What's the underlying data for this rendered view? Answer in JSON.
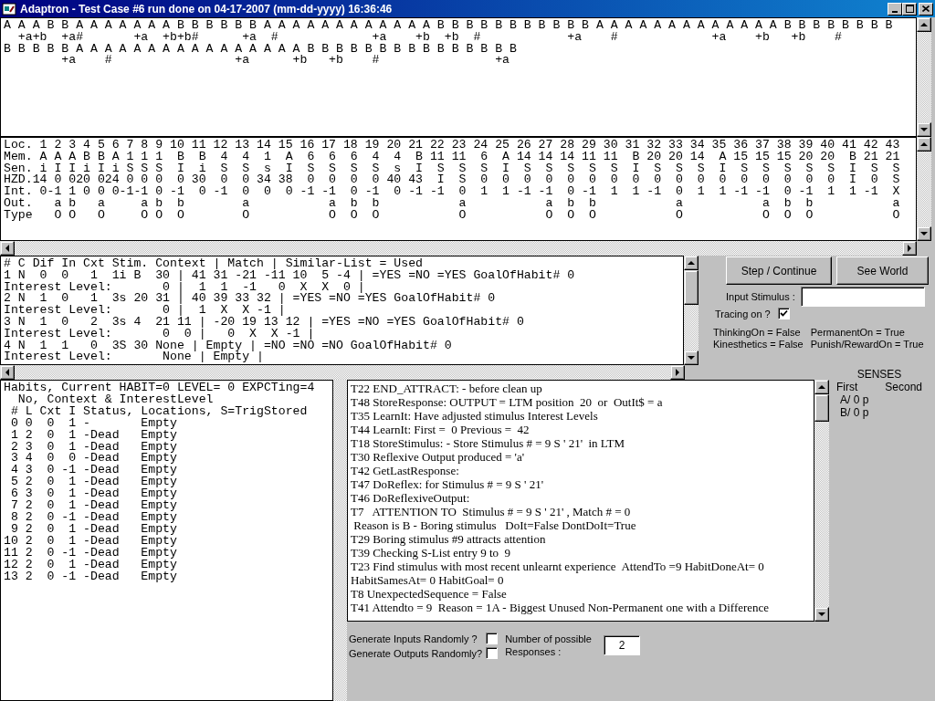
{
  "window": {
    "title": "Adaptron - Test Case #6 run done on 04-17-2007 (mm-dd-yyyy) 16:36:46"
  },
  "event_trace": {
    "lines": [
      "A A A B B A A A A A A A B B B B B B A A A A A A A A A A A A B B B B B B B B B B B A A A A A A A A A A A A A B B B B B B B B",
      "  +a+b  +a#       +a  +b+b#      +a  #             +a    +b  +b  #            +a    #             +a    +b   +b    #",
      "B B B B B A A A A A A A A A A A A A A A A B B B B B B B B B B B B B B B",
      "        +a    #                 +a      +b   +b    #                +a"
    ]
  },
  "ltm_table": {
    "lines": [
      "Loc. 1 2 3 4 5 6 7 8 9 10 11 12 13 14 15 16 17 18 19 20 21 22 23 24 25 26 27 28 29 30 31 32 33 34 35 36 37 38 39 40 41 42 43",
      "Mem. A A A B B A 1 1 1  B  B  4  4  1  A  6  6  6  4  4  B 11 11  6  A 14 14 14 11 11  B 20 20 14  A 15 15 15 20 20  B 21 21",
      "Sen. i I I i I i S S S  I  i  S  S  s  I  S  S  S  S  s  I  S  S  S  I  S  S  S  S  S  I  S  S  S  I  S  S  S  S  S  I  S  S",
      "HZD.14 0 020 024 0 0 0  0 30  0  0 34 38  0  0  0  0 40 43  I  S  0  0  0  0  0  0  0  0  0  0  0  0  0  0  0  0  0  I  0  S",
      "Int. 0-1 1 0 0 0-1-1 0 -1  0 -1  0  0  0 -1 -1  0 -1  0 -1 -1  0  1  1 -1 -1  0 -1  1  1 -1  0  1  1 -1 -1  0 -1  1  1 -1  X",
      "Out.   a b   a     a b  b        a           a  b  b           a           a  b  b           a           a  b  b           a",
      "Type   O O   O     O O  O        O           O  O  O           O           O  O  O           O           O  O  O           O"
    ]
  },
  "stimulus_list": {
    "lines": [
      "# C Dif In Cxt Stim. Context | Match | Similar-List = Used",
      "1 N  0  0   1  1i B  30 | 41 31 -21 -11 10  5 -4 | =YES =NO =YES GoalOfHabit# 0",
      "Interest Level:       0 |  1  1  -1   0  X  X  0 |",
      "2 N  1  0   1  3s 20 31 | 40 39 33 32 | =YES =NO =YES GoalOfHabit# 0",
      "Interest Level:       0 |  1  X  X -1 |",
      "3 N  1  0   2  3s 4  21 11 | -20 19 13 12 | =YES =NO =YES GoalOfHabit# 0",
      "Interest Level:       0  0 |   0  X  X -1 |",
      "4 N  1  1   0  3S 30 None | Empty | =NO =NO =NO GoalOfHabit# 0",
      "Interest Level:       None | Empty |"
    ]
  },
  "controls": {
    "buttons": [
      "Step / Continue",
      "See World"
    ],
    "input_stimulus": {
      "label": "Input Stimulus :"
    },
    "tracing": {
      "label": "Tracing on ?",
      "checked": true
    },
    "status": [
      "ThinkingOn = False",
      "PermanentOn = True",
      "Kinesthetics = False",
      "Punish/RewardOn = True"
    ]
  },
  "habits": {
    "lines": [
      "Habits, Current HABIT=0 LEVEL= 0 EXPCTing=4",
      "  No, Context & InterestLevel",
      " # L Cxt I Status, Locations, S=TrigStored",
      " 0 0  0  1 -       Empty",
      " 1 2  0  1 -Dead   Empty",
      " 2 3  0  1 -Dead   Empty",
      " 3 4  0  0 -Dead   Empty",
      " 4 3  0 -1 -Dead   Empty",
      " 5 2  0  1 -Dead   Empty",
      " 6 3  0  1 -Dead   Empty",
      " 7 2  0  1 -Dead   Empty",
      " 8 2  0 -1 -Dead   Empty",
      " 9 2  0  1 -Dead   Empty",
      "10 2  0  1 -Dead   Empty",
      "11 2  0 -1 -Dead   Empty",
      "12 2  0  1 -Dead   Empty",
      "13 2  0 -1 -Dead   Empty"
    ]
  },
  "trace_log": {
    "lines": [
      "T22 END_ATTRACT: - before clean up",
      "T48 StoreResponse: OUTPUT = LTM position  20  or  OutIt$ = a",
      "T35 LearnIt: Have adjusted stimulus Interest Levels",
      "T44 LearnIt: First =  0 Previous =  42",
      "T18 StoreStimulus: - Store Stimulus # = 9 S ' 21'  in LTM",
      "T30 Reflexive Output produced = 'a'",
      "T42 GetLastResponse:",
      "T47 DoReflex: for Stimulus # = 9 S ' 21'",
      "T46 DoReflexiveOutput:",
      "T7   ATTENTION TO  Stimulus # = 9 S ' 21' , Match # = 0",
      " Reason is B - Boring stimulus   DoIt=False DontDoIt=True",
      "T29 Boring stimulus #9 attracts attention",
      "T39 Checking S-List entry 9 to  9",
      "T23 Find stimulus with most recent unlearnt experience  AttendTo =9 HabitDoneAt= 0",
      "HabitSamesAt= 0 HabitGoal= 0",
      "T8 UnexpectedSequence = False",
      "T41 Attendto = 9  Reason = 1A - Biggest Unused Non-Permanent one with a Difference"
    ]
  },
  "senses": {
    "title": "SENSES",
    "columns": [
      "First",
      "Second"
    ],
    "rows": [
      "A/ 0 p",
      "B/ 0 p"
    ]
  },
  "options": {
    "checks": [
      {
        "label": "Generate Inputs Randomly ?",
        "checked": false
      },
      {
        "label": "Generate Outputs Randomly?",
        "checked": false
      }
    ],
    "responses": {
      "label": "Number of possible Responses :",
      "value": "2"
    }
  }
}
